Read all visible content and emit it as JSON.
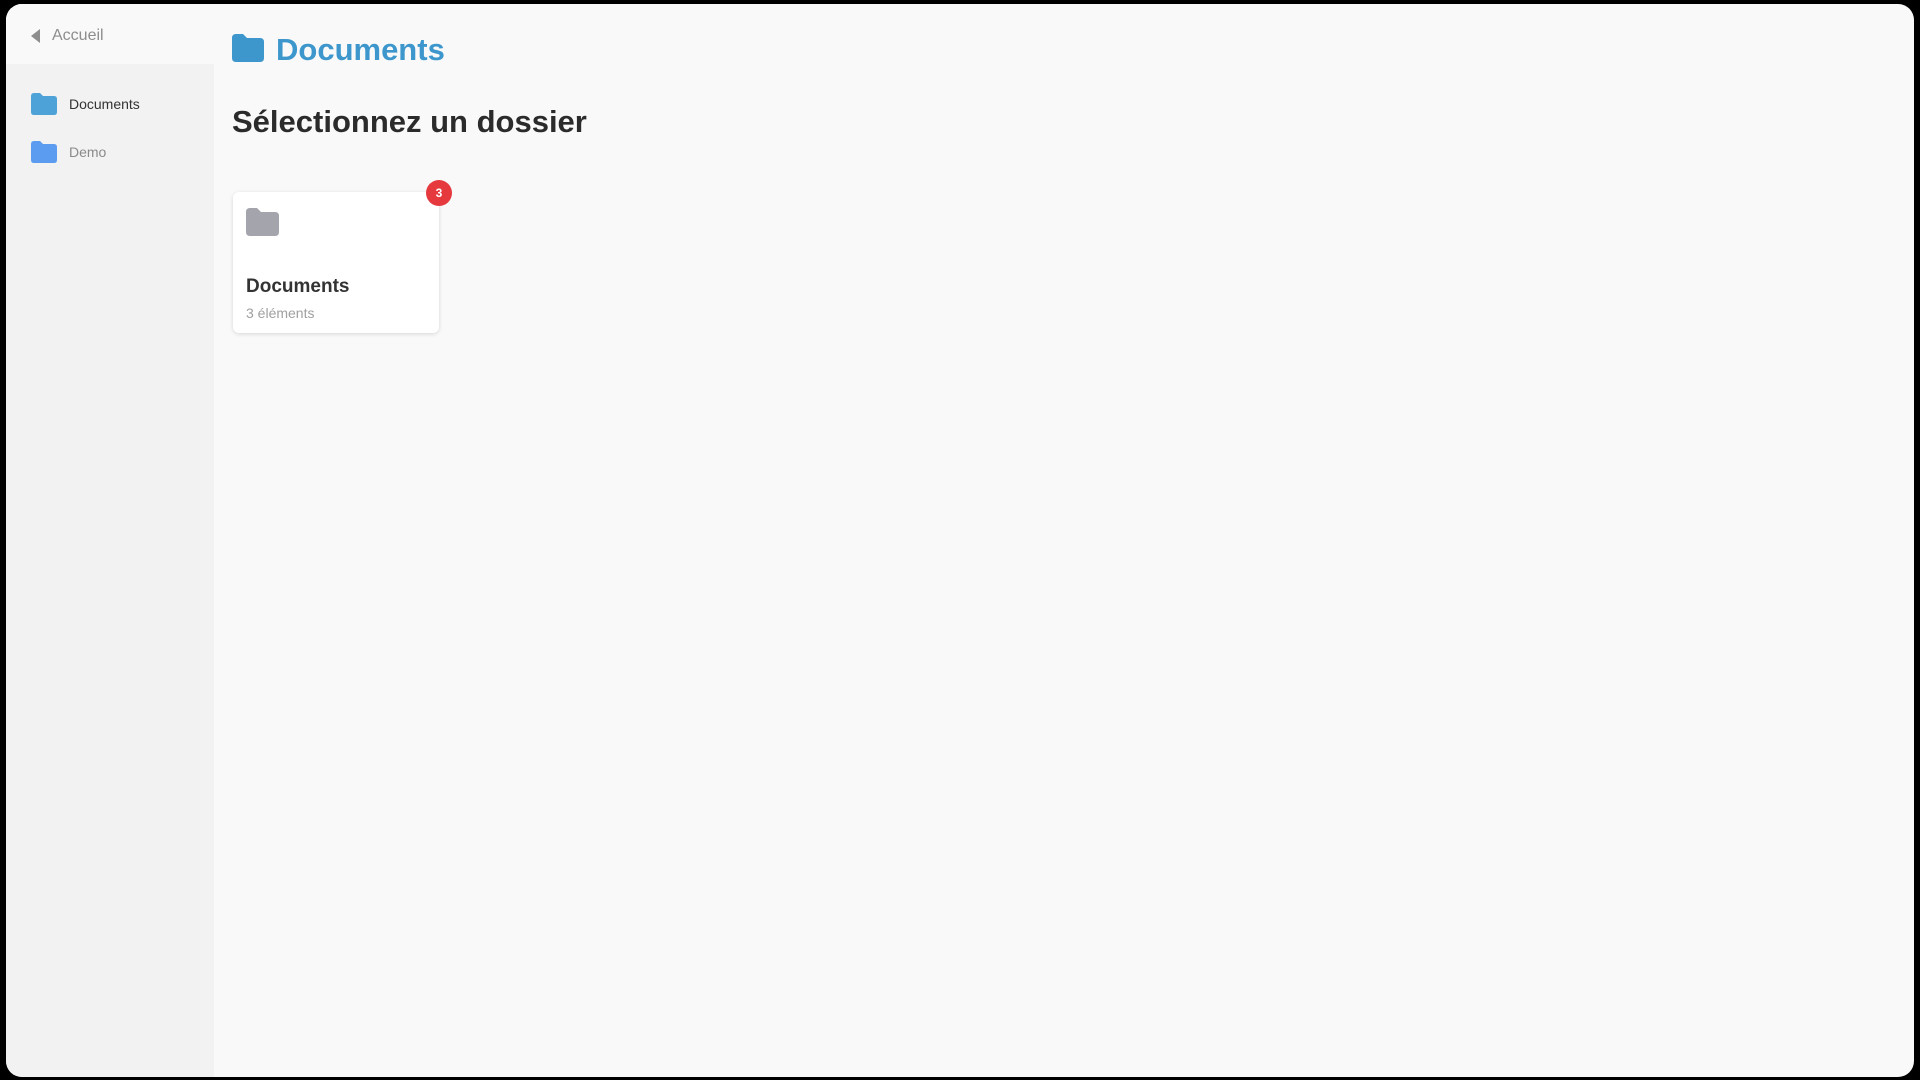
{
  "colors": {
    "accent": "#3d97cc",
    "sidebar_folder": "#4da3d8",
    "sidebar_folder_alt": "#5b9cf0",
    "card_folder": "#a4a4ad",
    "badge": "#e5393e"
  },
  "sidebar": {
    "back_label": "Accueil",
    "back_icon": "caret-left-icon",
    "items": [
      {
        "label": "Documents",
        "icon": "folder-icon",
        "active": true
      },
      {
        "label": "Demo",
        "icon": "folder-icon",
        "active": false
      }
    ]
  },
  "header": {
    "title": "Documents",
    "icon": "folder-icon"
  },
  "main": {
    "subtitle": "Sélectionnez un dossier",
    "folders": [
      {
        "title": "Documents",
        "count_label": "3 éléments",
        "badge": "3",
        "icon": "folder-icon"
      }
    ]
  }
}
